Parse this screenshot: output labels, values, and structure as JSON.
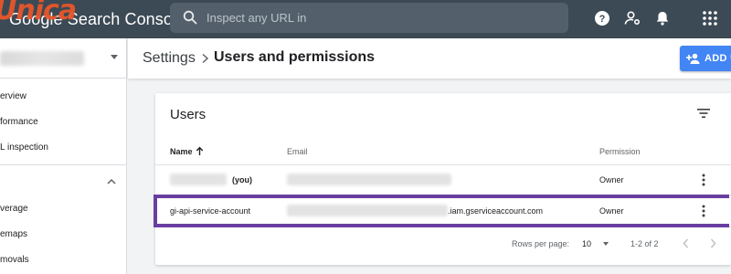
{
  "app": {
    "title": "Google Search Console",
    "watermark": "Unica"
  },
  "search": {
    "placeholder": "Inspect any URL in"
  },
  "topbar_icons": [
    "help-icon",
    "account-settings-icon",
    "notifications-icon",
    "apps-grid-icon"
  ],
  "sidebar": {
    "items": [
      {
        "label": "erview"
      },
      {
        "label": "formance"
      },
      {
        "label": "L inspection"
      },
      {
        "label": "verage"
      },
      {
        "label": "emaps"
      },
      {
        "label": "movals"
      }
    ]
  },
  "header": {
    "breadcrumb": "Settings",
    "title": "Users and permissions",
    "add_button": "ADD U"
  },
  "users_card": {
    "title": "Users",
    "columns": {
      "name": "Name",
      "email": "Email",
      "permission": "Permission"
    },
    "rows": [
      {
        "name_suffix": "(you)",
        "email": "",
        "permission": "Owner"
      },
      {
        "name": "gi-api-service-account",
        "email_suffix": ".iam.gserviceaccount.com",
        "permission": "Owner"
      }
    ],
    "pagination": {
      "rows_per_page_label": "Rows per page:",
      "rows_per_page": "10",
      "range": "1-2 of 2"
    }
  },
  "colors": {
    "topbar": "#3c4a55",
    "accent": "#4285f4",
    "highlight": "#6a3ea1",
    "watermark": "#e8562a"
  }
}
